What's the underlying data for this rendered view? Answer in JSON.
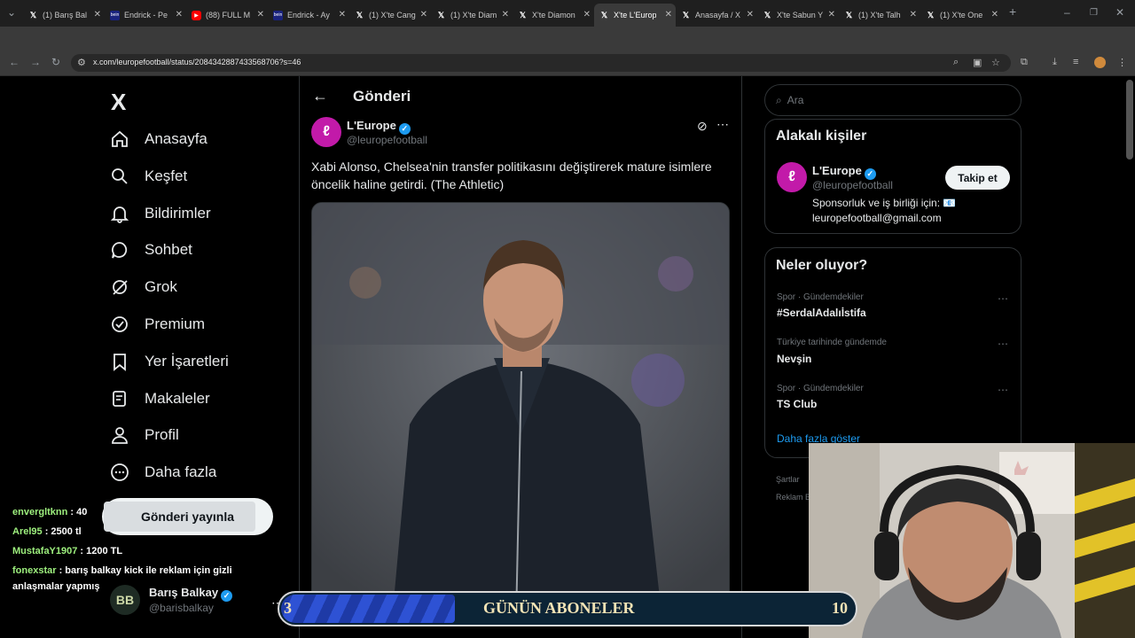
{
  "browser": {
    "tabs": [
      {
        "icon": "x",
        "title": "(1) Barış Bal"
      },
      {
        "icon": "b",
        "title": "Endrick - Pe"
      },
      {
        "icon": "yt",
        "title": "(88) FULL M"
      },
      {
        "icon": "b",
        "title": "Endrick - Ay"
      },
      {
        "icon": "x",
        "title": "(1) X'te Cang"
      },
      {
        "icon": "x",
        "title": "(1) X'te Diam"
      },
      {
        "icon": "x",
        "title": "X'te Diamon"
      },
      {
        "icon": "x",
        "title": "X'te L'Europ"
      },
      {
        "icon": "x",
        "title": "Anasayfa / X"
      },
      {
        "icon": "x",
        "title": "X'te Sabun Y"
      },
      {
        "icon": "x",
        "title": "(1) X'te Talh"
      },
      {
        "icon": "x",
        "title": "(1) X'te One"
      }
    ],
    "active_tab_index": 7,
    "url": "x.com/leuropefootball/status/2084342887433568706?s=46"
  },
  "sidebar": {
    "logo": "X",
    "items": [
      {
        "label": "Anasayfa",
        "icon": "home-icon"
      },
      {
        "label": "Keşfet",
        "icon": "search-icon"
      },
      {
        "label": "Bildirimler",
        "icon": "bell-icon"
      },
      {
        "label": "Sohbet",
        "icon": "chat-icon"
      },
      {
        "label": "Grok",
        "icon": "grok-icon"
      },
      {
        "label": "Premium",
        "icon": "premium-icon"
      },
      {
        "label": "Yer İşaretleri",
        "icon": "bookmark-icon"
      },
      {
        "label": "Makaleler",
        "icon": "article-icon"
      },
      {
        "label": "Profil",
        "icon": "profile-icon"
      },
      {
        "label": "Daha fazla",
        "icon": "more-icon"
      }
    ],
    "post_button": "Gönderi yayınla",
    "account": {
      "name": "Barış Balkay",
      "handle": "@barisbalkay",
      "initials": "BB"
    }
  },
  "chat": [
    {
      "user": "envergltknn",
      "msg": " : 40"
    },
    {
      "user": "Arel95",
      "msg": " : 2500 tl"
    },
    {
      "user": "MustafaY1907",
      "msg": " : 1200 TL"
    },
    {
      "user": "fonexstar",
      "msg": " : barış balkay kick ile reklam için gizli"
    },
    {
      "user": "",
      "msg": "anlaşmalar yapmış"
    }
  ],
  "post": {
    "header": "Gönderi",
    "author_name": "L'Europe",
    "author_handle": "@leuropefootball",
    "text": "Xabi Alonso, Chelsea'nin transfer politikasını değiştirerek mature isimlere öncelik haline getirdi. (The Athletic)"
  },
  "right": {
    "search_placeholder": "Ara",
    "relevant_title": "Alakalı kişiler",
    "relevant": {
      "name": "L'Europe",
      "handle": "@leuropefootball",
      "bio_line1": "Sponsorluk ve iş birliği için: 📧",
      "bio_line2": "leuropefootball@gmail.com",
      "follow": "Takip et"
    },
    "trends_title": "Neler oluyor?",
    "trends": [
      {
        "category": "Spor · Gündemdekiler",
        "name": "#SerdalAdalıİstifa"
      },
      {
        "category": "Türkiye tarihinde gündemde",
        "name": "Nevşin"
      },
      {
        "category": "Spor · Gündemdekiler",
        "name": "TS Club"
      }
    ],
    "show_more": "Daha fazla göster",
    "footer1": "Şartlar",
    "footer2": "Reklam B"
  },
  "banner": {
    "left": "3",
    "title": "GÜNÜN ABONELER",
    "right": "10"
  }
}
